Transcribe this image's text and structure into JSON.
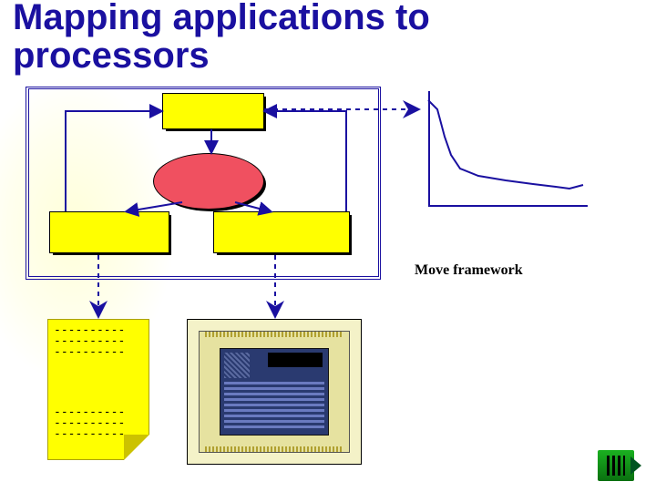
{
  "title_line1": "Mapping applications to",
  "title_line2": "processors",
  "chart_caption": "Move framework",
  "note": {
    "lines_top": [
      "----------",
      "----------",
      "----------"
    ],
    "lines_bottom": [
      "----------",
      "----------",
      "----------"
    ]
  },
  "colors": {
    "accent": "#1a10a0",
    "box_fill": "#ffff00",
    "ellipse_fill": "#f05060"
  },
  "chart_data": {
    "type": "line",
    "title": "",
    "xlabel": "",
    "ylabel": "",
    "xlim": [
      0,
      170
    ],
    "ylim": [
      0,
      120
    ],
    "series": [
      {
        "name": "curve",
        "x": [
          0,
          10,
          18,
          25,
          35,
          55,
          85,
          115,
          140,
          155,
          170
        ],
        "y": [
          115,
          105,
          75,
          55,
          40,
          32,
          27,
          23,
          20,
          18,
          22
        ]
      }
    ]
  }
}
